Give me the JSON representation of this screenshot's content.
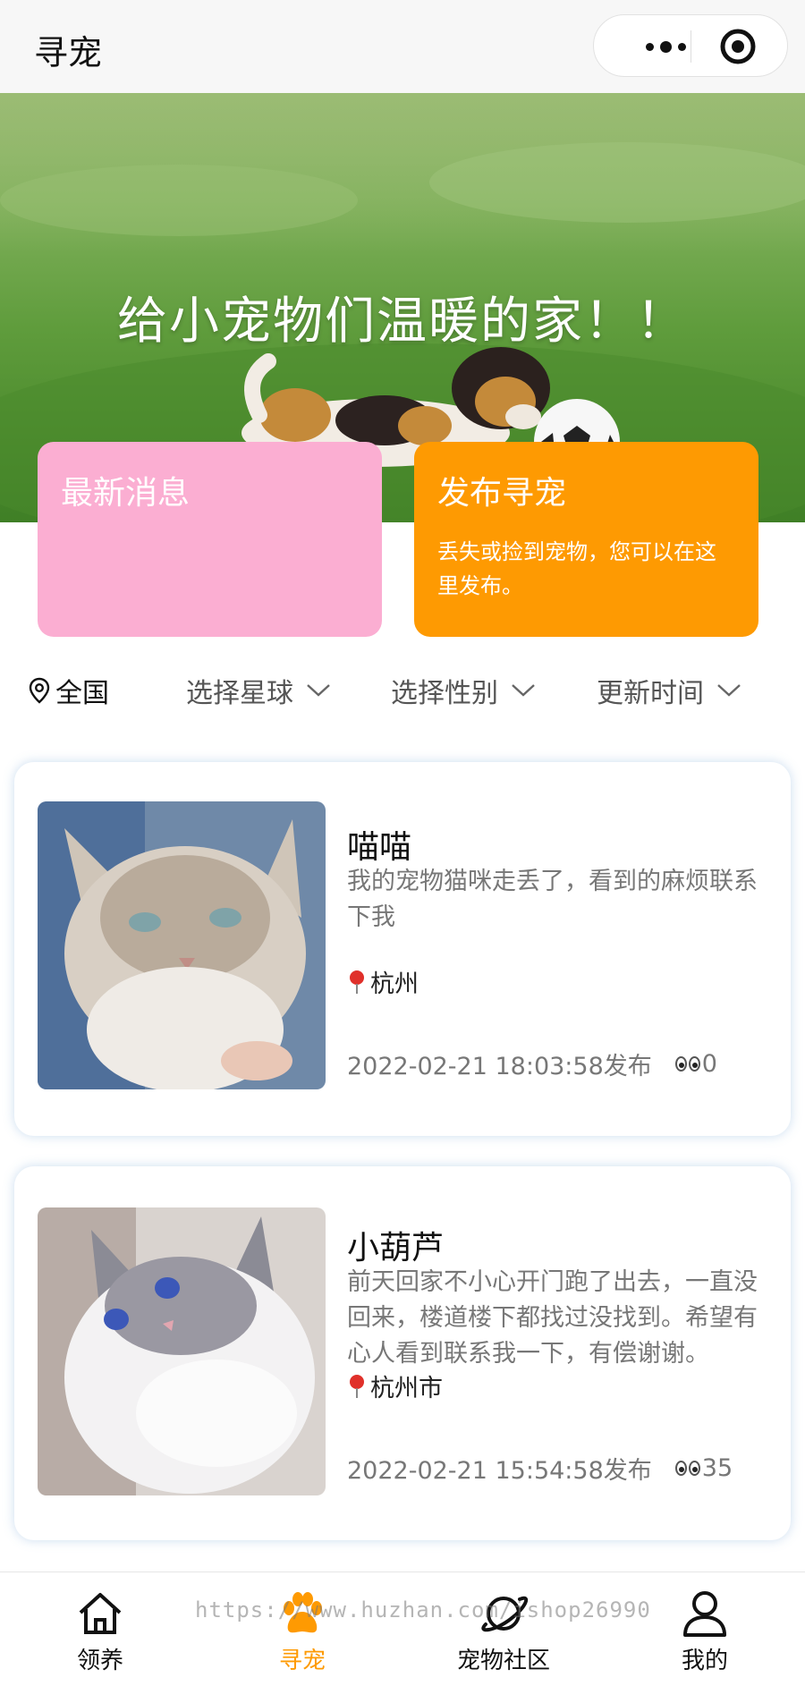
{
  "header": {
    "title": "寻宠"
  },
  "banner": {
    "slogan": "给小宠物们温暖的家！！"
  },
  "cards": {
    "news": {
      "title": "最新消息"
    },
    "post": {
      "title": "发布寻宠",
      "desc": "丢失或捡到宠物，您可以在这里发布。"
    }
  },
  "filter": {
    "location": "全国",
    "options": [
      "选择星球",
      "选择性别",
      "更新时间"
    ]
  },
  "pets": [
    {
      "name": "喵喵",
      "desc": "我的宠物猫咪走丢了，看到的麻烦联系下我",
      "place": "杭州",
      "time": "2022-02-21 18:03:58发布",
      "views": "0"
    },
    {
      "name": "小葫芦",
      "desc": "前天回家不小心开门跑了出去，一直没回来，楼道楼下都找过没找到。希望有心人看到联系我一下，有偿谢谢。",
      "place": "杭州市",
      "time": "2022-02-21 15:54:58发布",
      "views": "35"
    }
  ],
  "tabbar": {
    "items": [
      {
        "label": "领养",
        "icon": "home-icon"
      },
      {
        "label": "寻宠",
        "icon": "paw-icon"
      },
      {
        "label": "宠物社区",
        "icon": "planet-icon"
      },
      {
        "label": "我的",
        "icon": "user-icon"
      }
    ],
    "active_color": "#fe9a02"
  },
  "watermark": "https://www.huzhan.com/ishop26990",
  "colors": {
    "news_card": "#fbaed2",
    "post_card": "#fe9a02",
    "accent": "#fe9a02"
  }
}
